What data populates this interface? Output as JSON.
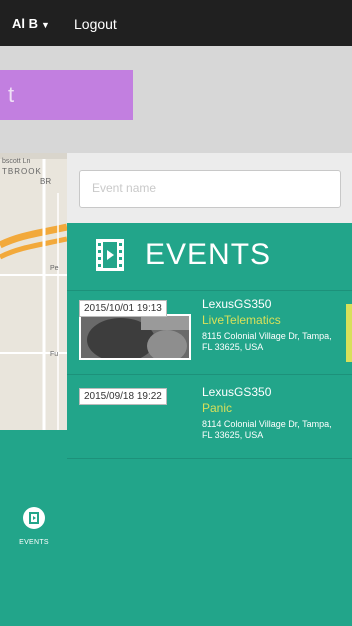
{
  "header": {
    "user_label": "Al B",
    "logout_label": "Logout"
  },
  "banner": {
    "text": "t"
  },
  "map": {
    "labels": [
      "bscott Ln",
      "TBROOK",
      "BR",
      "Pe",
      "Fu"
    ]
  },
  "search": {
    "placeholder": "Event name"
  },
  "events_panel": {
    "title": "EVENTS",
    "items": [
      {
        "timestamp": "2015/10/01 19:13",
        "vehicle": "LexusGS350",
        "type": "LiveTelematics",
        "address": "8115 Colonial Village Dr, Tampa, FL 33625, USA"
      },
      {
        "timestamp": "2015/09/18 19:22",
        "vehicle": "LexusGS350",
        "type": "Panic",
        "address": "8114 Colonial Village Dr, Tampa, FL 33625, USA"
      }
    ]
  },
  "nav": {
    "events_label": "EVENTS"
  },
  "colors": {
    "teal": "#22a58a",
    "accent_yellow": "#d8e05a",
    "purple": "#c27fe0",
    "topbar": "#202020"
  }
}
